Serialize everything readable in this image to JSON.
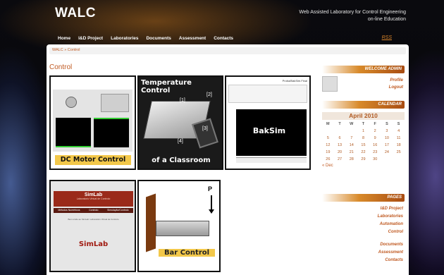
{
  "site": {
    "title": "WALC",
    "tagline": "Web Assisted Laboratory for Control Engineering on-line Education",
    "rss": "RSS"
  },
  "nav": [
    "Home",
    "I&D Project",
    "Laboratories",
    "Documents",
    "Assessment",
    "Contacts"
  ],
  "breadcrumb": "WALC » Control",
  "page_title": "Control",
  "tiles": {
    "dc_motor": {
      "label": "DC Motor Control"
    },
    "temperature": {
      "title": "Temperature Control",
      "caption": "of a Classroom",
      "markers": [
        "[1]",
        "[2]",
        "[3]",
        "[4]"
      ]
    },
    "baksim": {
      "label": "BakSim",
      "header": "Proba/BakSim.Final"
    },
    "simlab": {
      "brand": "SimLab",
      "subtitle": "Laboratorio Virtual de Controlo",
      "menu": [
        "Métodos Numéricos",
        "Controlo",
        "Simulação/Controlo"
      ],
      "label": "SimLab",
      "body": "Bem-vindo ao SimLab: Laboratório Virtual de Controlo"
    },
    "bar_control": {
      "label": "Bar Control",
      "force": "P"
    }
  },
  "sidebar": {
    "welcome": {
      "header": "WELCOME ADMIN",
      "links": [
        "Profile",
        "Logout"
      ]
    },
    "calendar": {
      "header": "CALENDAR",
      "month": "April 2010",
      "days": [
        "M",
        "T",
        "W",
        "T",
        "F",
        "S",
        "S"
      ],
      "weeks": [
        [
          "",
          "",
          "",
          "1",
          "2",
          "3",
          "4"
        ],
        [
          "5",
          "6",
          "7",
          "8",
          "9",
          "10",
          "11"
        ],
        [
          "12",
          "13",
          "14",
          "15",
          "16",
          "17",
          "18"
        ],
        [
          "19",
          "20",
          "21",
          "22",
          "23",
          "24",
          "25"
        ],
        [
          "26",
          "27",
          "28",
          "29",
          "30",
          "",
          ""
        ]
      ],
      "prev": "« Dec"
    },
    "pages": {
      "header": "PAGES",
      "links": [
        "I&D Project",
        "Laboratories",
        "Automation",
        "Control",
        "Documents",
        "Assessment",
        "Contacts"
      ]
    }
  },
  "colors": {
    "accent": "#c05a22",
    "nav_bar": "#2a1a0a"
  }
}
